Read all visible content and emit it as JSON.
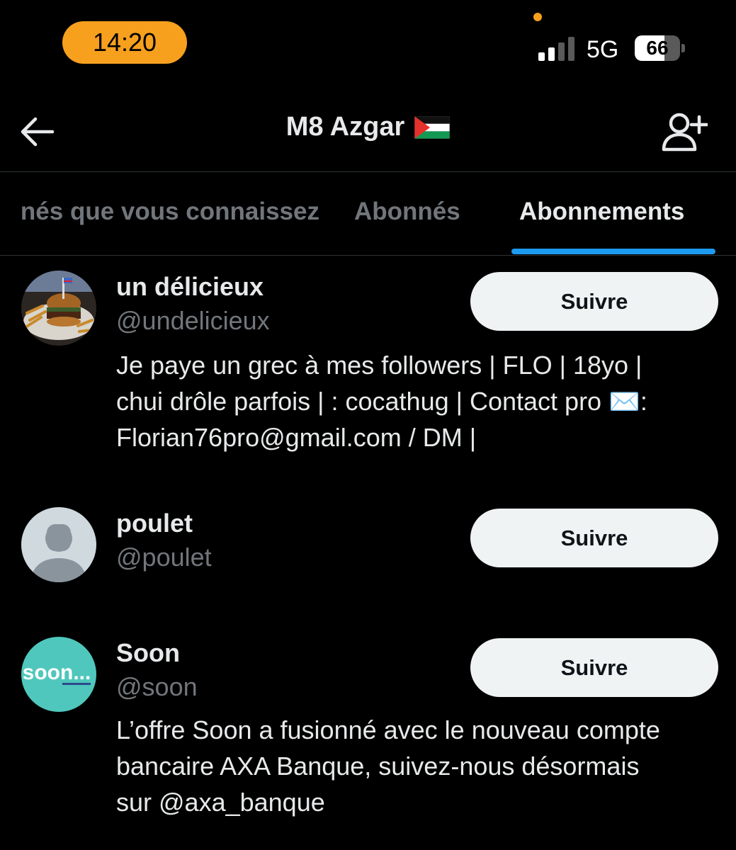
{
  "status_bar": {
    "time": "14:20",
    "network": "5G",
    "battery_level": "66",
    "battery_fraction": 0.66,
    "signal_bars_active": 2,
    "signal_bars_total": 4
  },
  "header": {
    "title": "M8 Azgar",
    "flag_icon": "palestine-flag-icon",
    "back_icon": "arrow-left-icon",
    "action_icon": "add-user-icon"
  },
  "tabs": [
    {
      "label": "Abonnés que vous connaissez",
      "visible_label": "nés que vous connaissez",
      "active": false
    },
    {
      "label": "Abonnés",
      "active": false
    },
    {
      "label": "Abonnements",
      "active": true
    }
  ],
  "colors": {
    "accent": "#1d9bf0",
    "time_pill": "#f7a01e",
    "background": "#000000",
    "button_bg": "#eff3f4"
  },
  "users": [
    {
      "name": "un délicieux",
      "handle": "@undelicieux",
      "bio_lines": [
        "Je paye un grec à mes followers | FLO | 18yo |",
        "chui drôle parfois | : cocathug | Contact pro ✉️:",
        "Florian76pro@gmail.com / DM |"
      ],
      "button": "Suivre",
      "avatar": "burger-photo"
    },
    {
      "name": "poulet",
      "handle": "@poulet",
      "bio_lines": [],
      "button": "Suivre",
      "avatar": "default-profile"
    },
    {
      "name": "Soon",
      "handle": "@soon",
      "bio_lines": [
        "L’offre Soon a fusionné avec le nouveau compte",
        "bancaire AXA Banque, suivez-nous désormais",
        "sur @axa_banque"
      ],
      "button": "Suivre",
      "avatar": "soon-logo",
      "avatar_logo_text": "soon..."
    }
  ]
}
